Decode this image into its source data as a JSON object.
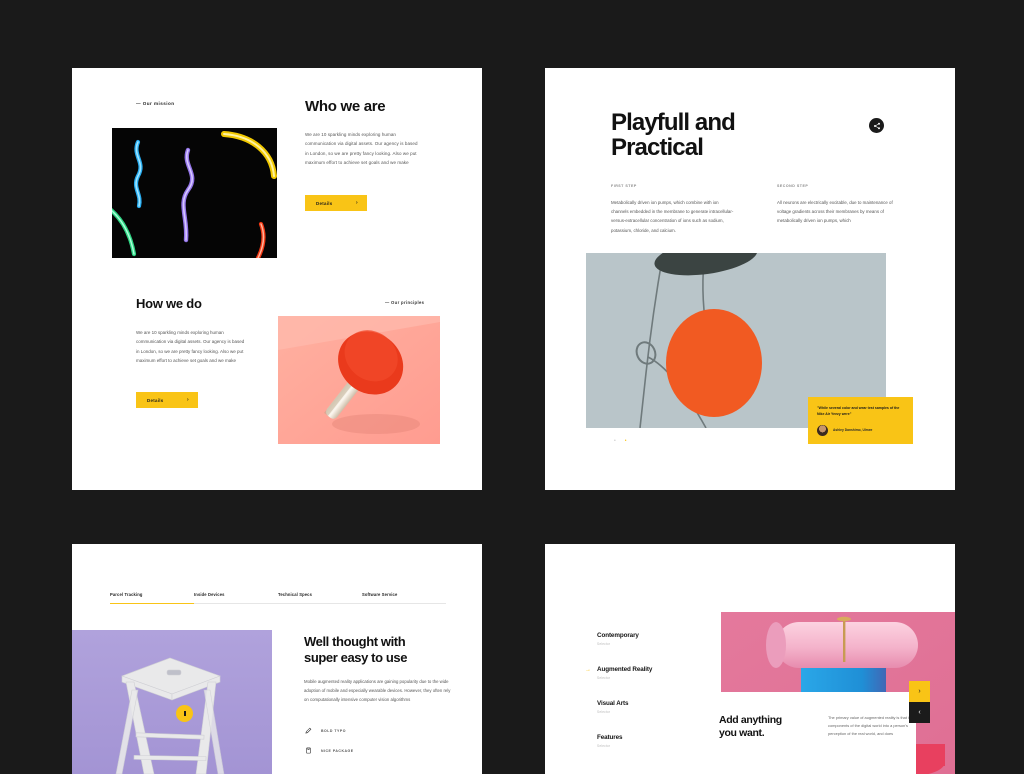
{
  "theme": {
    "accent_yellow": "#f9c416",
    "ink": "#111111",
    "page_bg": "#1a1a1a",
    "panel_bg": "#ffffff"
  },
  "panel_mission": {
    "eyebrow": "— Our mission",
    "heading": "Who we are",
    "body": "We are 10 sparkling minds exploring human communication via digital assets. Our agency is based in London, so we are pretty fancy looking. Also we put maximum effort to achieve set goals and we make",
    "details_label": "Details",
    "details_arrow": "›",
    "image_alt": "neon-light-squiggles-photo",
    "heading2": "How we do",
    "eyebrow2": "— Our principles",
    "body2": "We are 10 sparkling minds exploring human communication via digital assets. Our agency is based in London, so we are pretty fancy looking. Also we put maximum effort to achieve set goals and we make",
    "details_label2": "Details",
    "details_arrow2": "›",
    "image2_alt": "red-ping-pong-paddle-on-pink-photo"
  },
  "panel_playfull": {
    "heading_line1": "Playfull and",
    "heading_line2": "Practical",
    "share_icon": "share-icon",
    "share_glyph": "◄",
    "columns": [
      {
        "step": "FIRST STEP",
        "text": "Metabolically driven ion pumps, which combine with ion channels embedded in the membrane to generate intracellular-versus-extracellular concentration of ions such as sodium, potassium, chloride, and calcium."
      },
      {
        "step": "SECOND STEP",
        "text": "All neurons are electrically excitable, due to maintenance of voltage gradients across their membranes by means of metabolically driven ion pumps, which"
      }
    ],
    "image_alt": "calder-mobile-sculpture-orange-disc-photo",
    "pagination": [
      "•",
      "•"
    ],
    "pagination_active_index": 1,
    "quote": {
      "text": "\"While several color and wear test samples of the Nike Air Yeezy were\"",
      "author": "Ashley Danshimo, Ulmee",
      "avatar_alt": "author-portrait"
    }
  },
  "panel_wellthought": {
    "nav": [
      {
        "label": "Parcel Tracking",
        "active": true
      },
      {
        "label": "Inside Devices",
        "active": false
      },
      {
        "label": "Technical Specs",
        "active": false
      },
      {
        "label": "Software Service",
        "active": false
      }
    ],
    "image_alt": "white-wooden-stool-on-lavender-photo",
    "hotspot_label": "hotspot",
    "heading_line1": "Well thought with",
    "heading_line2": "super easy to use",
    "body": "Mobile augmented reality applications are gaining popularity due to the wide adoption of mobile and especially wearable devices. However, they often rely on computationally intensive computer vision algorithms",
    "features": [
      {
        "icon": "pen-icon",
        "glyph": "✎",
        "label": "BOLD TYPO"
      },
      {
        "icon": "box-icon",
        "glyph": "🗍",
        "label": "NICE PACKAGE"
      }
    ]
  },
  "panel_addanything": {
    "sidebar": [
      {
        "label": "Contemporary",
        "sub": "Selector",
        "active": false
      },
      {
        "label": "Augmented Reality",
        "sub": "Selector",
        "active": true
      },
      {
        "label": "Visual Arts",
        "sub": "Selector",
        "active": false
      },
      {
        "label": "Features",
        "sub": "Selector",
        "active": false
      }
    ],
    "active_arrow": "→",
    "image_alt": "pink-cylinder-blue-cube-3d-render",
    "heading_line1": "Add anything",
    "heading_line2": "you want.",
    "body": "The primary value of augmented reality is that it brings components of the digital world into a person's perception of the real world, and does",
    "next_button_glyph": "›",
    "prev_button_glyph": "‹"
  }
}
